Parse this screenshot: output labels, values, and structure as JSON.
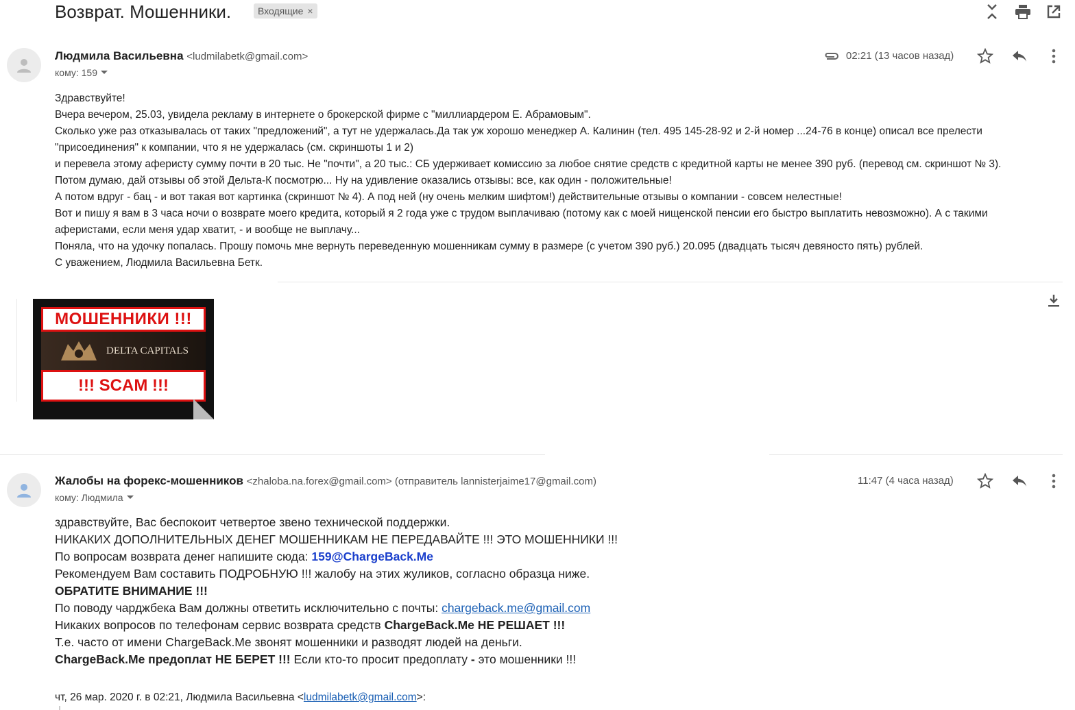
{
  "subject": "Возврат. Мошенники.",
  "label": "Входящие",
  "label_close": "×",
  "top_icons": [
    "collapse-icon",
    "print-icon",
    "open-new-window-icon"
  ],
  "message1": {
    "sender_name": "Людмила Васильевна",
    "sender_email": "<ludmilabetk@gmail.com>",
    "recipient": "кому: 159",
    "time": "02:21 (13 часов назад)",
    "body": [
      "Здравствуйте!",
      "Вчера вечером, 25.03, увидела рекламу в интернете о брокерской фирме с \"миллиардером Е. Абрамовым\".",
      "Сколько уже раз отказывалась от таких \"предложений\", а тут не удержалась.Да так уж хорошо менеджер А. Калинин (тел. 495 145-28-92 и 2-й номер ...24-76 в конце) описал все прелести",
      "\"присоединения\" к компании, что я не удержалась (см. скриншоты 1 и 2)",
      "и перевела этому аферисту сумму почти в 20 тыс. Не \"почти\", а 20 тыс.: СБ удерживает комиссию за любое снятие средств с кредитной карты не менее 390 руб. (перевод см. скриншот № 3).",
      "Потом думаю, дай отзывы об этой Дельта-К посмотрю... Ну на удивление оказались отзывы: все, как один - положительные!",
      "А потом вдруг - бац - и вот такая вот картинка (скриншот № 4). А под ней (ну очень мелким шифтом!) действительные отзывы о компании - совсем нелестные!",
      "Вот и пишу я вам в 3 часа ночи о возврате моего кредита, который я 2 года уже с трудом выплачиваю (потому как с моей нищенской пенсии его быстро выплатить невозможно). А с такими",
      "аферистами, если  меня удар хватит, - и вообще не выплачу...",
      "Поняла, что на удочку попалась. Прошу помочь мне вернуть переведенную мошенникам сумму в размере (с учетом 390 руб.) 20.095  (двадцать тысяч девяносто пять) рублей.",
      "С уважением, Людмила Васильевна Бетк."
    ],
    "attachment": {
      "top_text": "МОШЕННИКИ !!!",
      "brand_text": "DELTA CAPITALS",
      "bottom_text": "!!! SCAM !!!"
    }
  },
  "message2": {
    "sender_name": "Жалобы на форекс-мошенников",
    "sender_email": "<zhaloba.na.forex@gmail.com> (отправитель lannisterjaime17@gmail.com)",
    "recipient": "кому: Людмила",
    "time": "11:47 (4 часа назад)",
    "line1": "здравствуйте, Вас беспокоит четвертое звено технической поддержки.",
    "line2": "НИКАКИХ ДОПОЛНИТЕЛЬНЫХ ДЕНЕГ МОШЕННИКАМ НЕ ПЕРЕДАВАЙТЕ !!! ЭТО МОШЕННИКИ !!!",
    "line3_prefix": "По вопросам возврата денег напишите сюда: ",
    "line3_link": "159@ChargeBack.Me",
    "line4": "Рекомендуем Вам составить ПОДРОБНУЮ !!! жалобу на этих жуликов, согласно образца ниже.",
    "line5": "ОБРАТИТЕ ВНИМАНИЕ !!!",
    "line6_prefix": "По поводу чарджбека Вам должны ответить исключительно с почты: ",
    "line6_link": "chargeback.me@gmail.com",
    "line7_prefix": "Никаких вопросов по телефонам сервис возврата средств ",
    "line7_bold": "ChargeBack.Me НЕ РЕШАЕТ !!!",
    "line8": "Т.е. часто от имени ChargeBack.Me звонят мошенники и разводят людей на деньги.",
    "line9_bold": "ChargeBack.Me предоплат НЕ БЕРЕТ !!!",
    "line9_rest": " Если кто-то просит предоплату",
    "line9_bold2": " - ",
    "line9_end": "это мошенники !!!",
    "quote_prefix": "чт, 26 мар. 2020 г. в 02:21, Людмила Васильевна <",
    "quote_link": "ludmilabetk@gmail.com",
    "quote_suffix": ">:"
  },
  "colors": {
    "link": "#1a5fb4",
    "link_bold": "#1a3fcc",
    "warning_red": "#d11"
  }
}
